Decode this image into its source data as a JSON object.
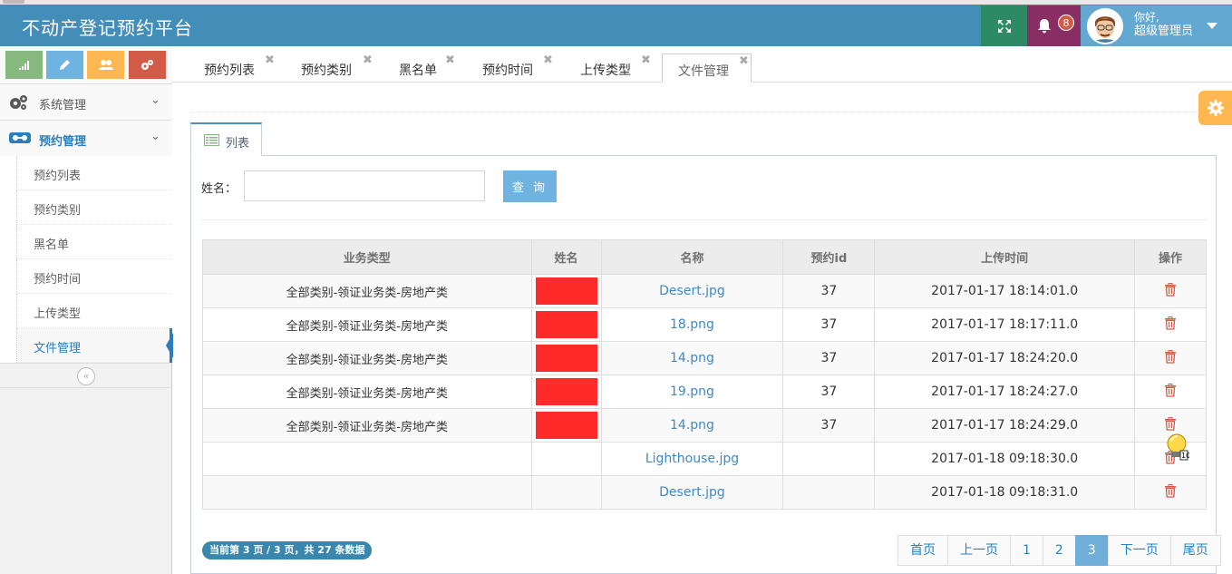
{
  "header": {
    "title": "不动产登记预约平台",
    "notification_count": "8",
    "user_greeting": "你好,",
    "user_name": "超级管理员",
    "colors": {
      "bar": "#438eb9",
      "fullscreen": "#2e8965",
      "bell": "#892e65",
      "user": "#62a8d1"
    }
  },
  "sidebar": {
    "shortcut_icons": [
      "signal-icon",
      "pencil-icon",
      "group-icon",
      "cogs-icon"
    ],
    "menus": [
      {
        "label": "系统管理",
        "icon": "cogs-icon"
      },
      {
        "label": "预约管理",
        "icon": "list-icon"
      }
    ],
    "submenu": [
      {
        "label": "预约列表"
      },
      {
        "label": "预约类别"
      },
      {
        "label": "黑名单"
      },
      {
        "label": "预约时间"
      },
      {
        "label": "上传类型"
      },
      {
        "label": "文件管理"
      }
    ],
    "collapse_icon": "double-left-icon"
  },
  "tabs": [
    {
      "label": "预约列表"
    },
    {
      "label": "预约类别"
    },
    {
      "label": "黑名单"
    },
    {
      "label": "预约时间"
    },
    {
      "label": "上传类型"
    },
    {
      "label": "文件管理"
    }
  ],
  "panel": {
    "tab_label": "列表",
    "search": {
      "label": "姓名：",
      "value": "",
      "placeholder": "",
      "button": "查 询"
    }
  },
  "table": {
    "columns": [
      "业务类型",
      "姓名",
      "名称",
      "预约id",
      "上传时间",
      "操作"
    ],
    "rows": [
      {
        "type": "全部类别-领证业务类-房地产类",
        "name_redacted": true,
        "file": "Desert.jpg",
        "id": "37",
        "time": "2017-01-17 18:14:01.0"
      },
      {
        "type": "全部类别-领证业务类-房地产类",
        "name_redacted": true,
        "file": "18.png",
        "id": "37",
        "time": "2017-01-17 18:17:11.0"
      },
      {
        "type": "全部类别-领证业务类-房地产类",
        "name_redacted": true,
        "file": "14.png",
        "id": "37",
        "time": "2017-01-17 18:24:20.0"
      },
      {
        "type": "全部类别-领证业务类-房地产类",
        "name_redacted": true,
        "file": "19.png",
        "id": "37",
        "time": "2017-01-17 18:24:27.0"
      },
      {
        "type": "全部类别-领证业务类-房地产类",
        "name_redacted": true,
        "file": "14.png",
        "id": "37",
        "time": "2017-01-17 18:24:29.0"
      },
      {
        "type": "",
        "name_redacted": false,
        "file": "Lighthouse.jpg",
        "id": "",
        "time": "2017-01-18 09:18:30.0"
      },
      {
        "type": "",
        "name_redacted": false,
        "file": "Desert.jpg",
        "id": "",
        "time": "2017-01-18 09:18:31.0"
      }
    ],
    "action_icon": "trash-icon"
  },
  "footer": {
    "page_info": "当前第 3 页 / 3 页，共 27 条数据",
    "pager": [
      "首页",
      "上一页",
      "1",
      "2",
      "3",
      "下一页",
      "尾页"
    ],
    "current_page": "3"
  }
}
